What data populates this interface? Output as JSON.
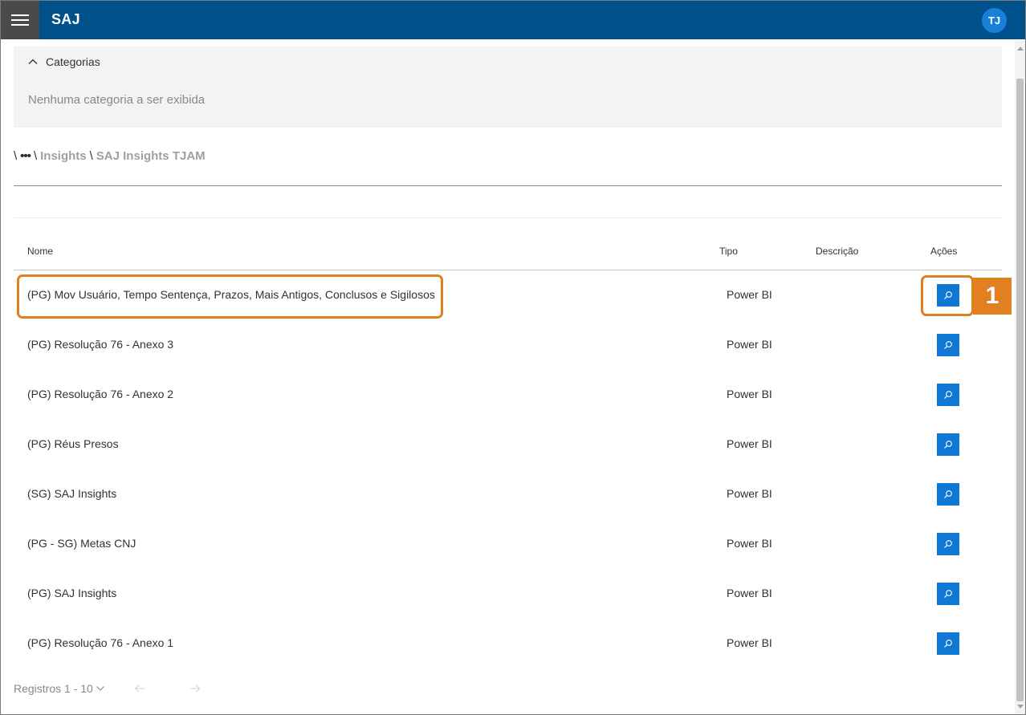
{
  "header": {
    "app_title": "SAJ",
    "avatar_initials": "TJ",
    "brand_color": "#00508c"
  },
  "categories": {
    "title": "Categorias",
    "empty_text": "Nenhuma categoria a ser exibida"
  },
  "breadcrumb": {
    "separator": "\\",
    "ellipsis": "•••",
    "items": [
      "Insights",
      "SAJ Insights TJAM"
    ]
  },
  "table": {
    "columns": {
      "name": "Nome",
      "type": "Tipo",
      "description": "Descrição",
      "actions": "Ações"
    },
    "rows": [
      {
        "name": "(PG) Mov Usuário, Tempo Sentença, Prazos, Mais Antigos, Conclusos e Sigilosos",
        "type": "Power BI",
        "description": ""
      },
      {
        "name": "(PG) Resolução 76 - Anexo 3",
        "type": "Power BI",
        "description": ""
      },
      {
        "name": "(PG) Resolução 76 - Anexo 2",
        "type": "Power BI",
        "description": ""
      },
      {
        "name": "(PG) Réus Presos",
        "type": "Power BI",
        "description": ""
      },
      {
        "name": "(SG) SAJ Insights",
        "type": "Power BI",
        "description": ""
      },
      {
        "name": "(PG - SG) Metas CNJ",
        "type": "Power BI",
        "description": ""
      },
      {
        "name": "(PG) SAJ Insights",
        "type": "Power BI",
        "description": ""
      },
      {
        "name": "(PG) Resolução 76 - Anexo 1",
        "type": "Power BI",
        "description": ""
      }
    ],
    "action_icon": "search-icon"
  },
  "annotation": {
    "step_number": "1",
    "color": "#e08020"
  },
  "pagination": {
    "label": "Registros 1 - 10"
  }
}
